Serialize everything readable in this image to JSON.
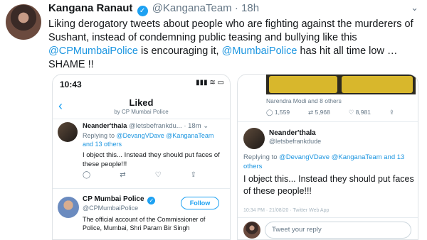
{
  "tweet": {
    "author_name": "Kangana Ranaut",
    "author_handle": "@KanganaTeam",
    "separator": "·",
    "time": "18h",
    "text_1": "Liking derogatory tweets about people who are fighting against the murderers of Sushant, instead of condemning public teasing and bullying like this ",
    "mention_1": "@CPMumbaiPolice",
    "text_2": " is encouraging it, ",
    "mention_2": "@MumbaiPolice",
    "text_3": " has hit all time low … SHAME !!"
  },
  "left_shot": {
    "status_time": "10:43",
    "status_icons": "▮▮▮ ≋ ▭",
    "back_icon": "‹",
    "title": "Liked",
    "subtitle": "by CP Mumbai Police",
    "reply_tweet": {
      "name": "Neander'thala",
      "handle": "@letsbefrankdu...",
      "time": "· 18m",
      "more": "⌄",
      "replying_to": "Replying to ",
      "reply_mentions": "@DevangVDave @KanganaTeam and 13 others",
      "body": "I object this... Instead they should put faces of these people!!!",
      "actions": [
        "◯",
        "⇄",
        "♡",
        "⇪"
      ]
    },
    "profile": {
      "name": "CP Mumbai Police",
      "handle": "@CPMumbaiPolice",
      "follow_label": "Follow",
      "bio": "The official account of the Commissioner of Police, Mumbai, Shri Param Bir Singh"
    }
  },
  "right_shot": {
    "liked_by": "Narendra Modi and 8 others",
    "actions": [
      "◯ 1,559",
      "⇄ 5,968",
      "♡ 8,981",
      "⇪"
    ],
    "name": "Neander'thala",
    "handle": "@letsbefrankdude",
    "replying_prefix": "Replying to ",
    "replying_mentions": "@DevangVDave @KanganaTeam and 13 others",
    "body": "I object this... Instead they should put faces of these people!!!",
    "time_line": "10:34 PM · 21/08/20 · Twitter Web App",
    "reply_placeholder": "Tweet your reply"
  },
  "colors": {
    "link": "#1b95e0",
    "verified": "#1da1f2",
    "muted": "#657786"
  },
  "icons": {
    "verified": "verified-badge-icon",
    "caret": "chevron-down-icon"
  }
}
